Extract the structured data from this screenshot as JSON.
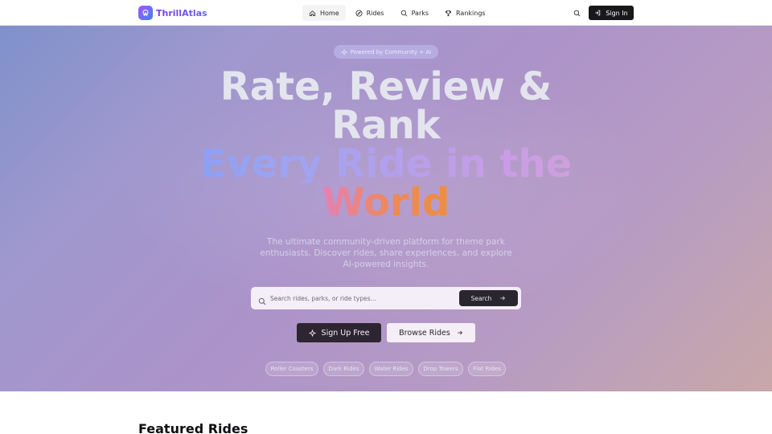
{
  "brand": {
    "name": "ThrillAtlas"
  },
  "nav": [
    {
      "label": "Home",
      "icon": "home-icon",
      "active": true
    },
    {
      "label": "Rides",
      "icon": "compass-icon",
      "active": false
    },
    {
      "label": "Parks",
      "icon": "search-icon",
      "active": false
    },
    {
      "label": "Rankings",
      "icon": "trophy-icon",
      "active": false
    }
  ],
  "header": {
    "signin_label": "Sign In"
  },
  "hero": {
    "badge": "Powered by Community + AI",
    "headline_line1": "Rate, Review &",
    "headline_line2": "Rank",
    "headline_gradient_1": "Every Ride in the",
    "headline_gradient_2": "World",
    "subtitle": "The ultimate community-driven platform for theme park enthusiasts. Discover rides, share experiences, and explore AI-powered insights.",
    "search": {
      "placeholder": "Search rides, parks, or ride types...",
      "button_label": "Search"
    },
    "cta_primary": "Sign Up Free",
    "cta_secondary": "Browse Rides",
    "chips": [
      "Roller Coasters",
      "Dark Rides",
      "Water Rides",
      "Drop Towers",
      "Flat Rides"
    ]
  },
  "sections": {
    "featured_title": "Featured Rides"
  },
  "colors": {
    "accent": "#7c3aed",
    "dark_button": "#18181b"
  }
}
